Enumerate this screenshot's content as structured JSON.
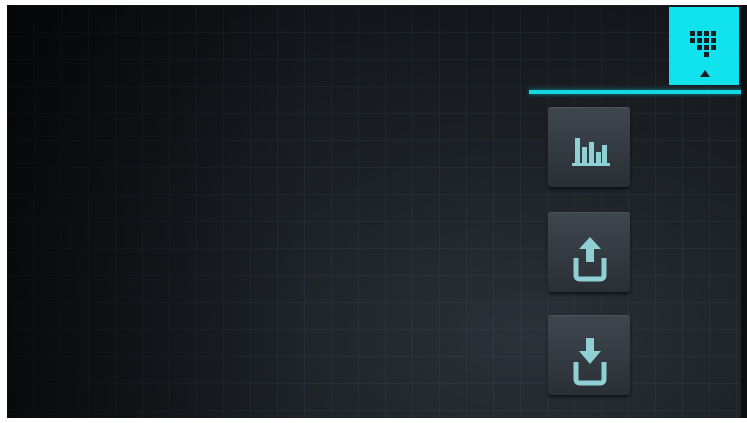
{
  "toolbar": {
    "menu_toggle": {
      "icon": "keypad-icon",
      "state": "active"
    },
    "buttons": [
      {
        "id": "chart",
        "icon": "bar-chart-icon"
      },
      {
        "id": "upload",
        "icon": "upload-tray-icon"
      },
      {
        "id": "download",
        "icon": "download-tray-icon"
      }
    ]
  },
  "colors": {
    "accent": "#10e3ee",
    "icon": "#8fd0d4",
    "button": "#3a4047",
    "background": "#16191d"
  }
}
